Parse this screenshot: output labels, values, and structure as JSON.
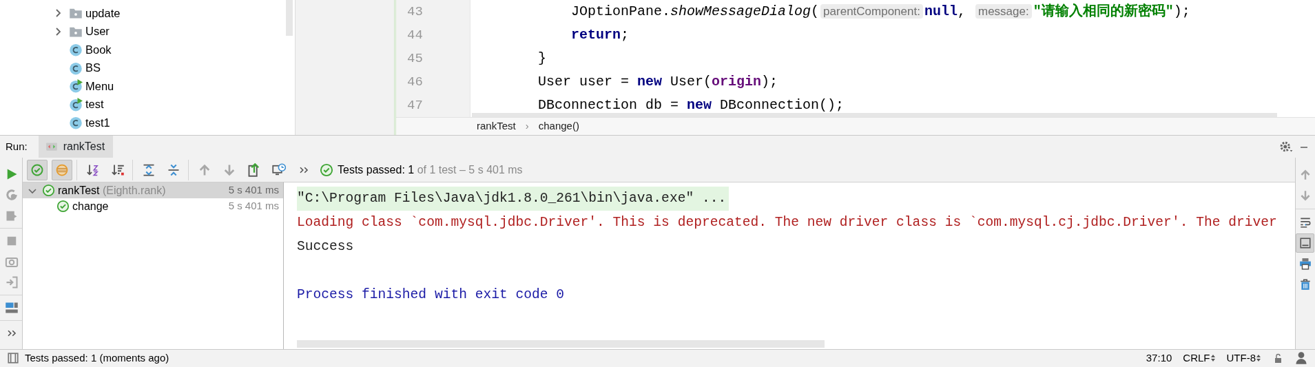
{
  "project_tree": {
    "items": [
      {
        "label": "update",
        "kind": "folder",
        "expanded": false
      },
      {
        "label": "User",
        "kind": "folder",
        "expanded": false
      },
      {
        "label": "Book",
        "kind": "class"
      },
      {
        "label": "BS",
        "kind": "class"
      },
      {
        "label": "Menu",
        "kind": "runnable-class"
      },
      {
        "label": "test",
        "kind": "runnable-class"
      },
      {
        "label": "test1",
        "kind": "class"
      }
    ]
  },
  "editor": {
    "lines": [
      {
        "number": "43",
        "tokens": [
          {
            "kind": "plain",
            "text": "            JOptionPane."
          },
          {
            "kind": "method",
            "text": "showMessageDialog"
          },
          {
            "kind": "plain",
            "text": "("
          },
          {
            "kind": "hint",
            "text": "parentComponent:"
          },
          {
            "kind": "keyword",
            "text": "null"
          },
          {
            "kind": "plain",
            "text": ", "
          },
          {
            "kind": "hint",
            "text": "message:"
          },
          {
            "kind": "string",
            "text": "\"请输入相同的新密码\""
          },
          {
            "kind": "plain",
            "text": ");"
          }
        ]
      },
      {
        "number": "44",
        "tokens": [
          {
            "kind": "keyword",
            "text": "            return"
          },
          {
            "kind": "plain",
            "text": ";"
          }
        ]
      },
      {
        "number": "45",
        "tokens": [
          {
            "kind": "plain",
            "text": "        }"
          }
        ]
      },
      {
        "number": "46",
        "tokens": [
          {
            "kind": "plain",
            "text": "        User user = "
          },
          {
            "kind": "keyword",
            "text": "new"
          },
          {
            "kind": "plain",
            "text": " User("
          },
          {
            "kind": "field",
            "text": "origin"
          },
          {
            "kind": "plain",
            "text": ");"
          }
        ]
      },
      {
        "number": "47",
        "tokens": [
          {
            "kind": "plain",
            "text": "        DBconnection db = "
          },
          {
            "kind": "keyword",
            "text": "new"
          },
          {
            "kind": "plain",
            "text": " DBconnection();"
          }
        ]
      }
    ],
    "breadcrumbs": [
      "rankTest",
      "change()"
    ],
    "separator": "›"
  },
  "run_panel": {
    "label": "Run:",
    "tabs": [
      {
        "label": "rankTest",
        "selected": true
      }
    ],
    "side_toolbar": [
      [
        {
          "kind": "run",
          "disabled": false
        },
        {
          "kind": "rerun-failed",
          "disabled": true
        },
        {
          "kind": "auto-test",
          "disabled": true
        }
      ],
      [
        {
          "kind": "stop",
          "disabled": true
        },
        {
          "kind": "camera",
          "disabled": true
        },
        {
          "kind": "exit",
          "disabled": true
        }
      ],
      [
        {
          "kind": "layout",
          "disabled": false
        }
      ],
      [
        {
          "kind": "more",
          "disabled": false
        }
      ]
    ],
    "toolbar": [
      [
        {
          "kind": "filter-passed",
          "on": true,
          "disabled": false
        },
        {
          "kind": "filter-ignored",
          "on": true,
          "disabled": false
        }
      ],
      [
        {
          "kind": "sort-alpha",
          "on": false,
          "disabled": false
        },
        {
          "kind": "sort-duration",
          "on": false,
          "disabled": false
        }
      ],
      [
        {
          "kind": "expand-all",
          "on": false,
          "disabled": false
        },
        {
          "kind": "collapse-all",
          "on": false,
          "disabled": false
        }
      ],
      [
        {
          "kind": "previous",
          "on": false,
          "disabled": true
        },
        {
          "kind": "next",
          "on": false,
          "disabled": true
        },
        {
          "kind": "export",
          "on": false,
          "disabled": false
        },
        {
          "kind": "history",
          "on": false,
          "disabled": false
        },
        {
          "kind": "more",
          "on": false,
          "disabled": false
        }
      ]
    ],
    "summary": {
      "status": "Tests passed:",
      "count": "1",
      "detail": "of 1 test – 5 s 401 ms"
    },
    "tests": [
      {
        "name": "rankTest",
        "qualifier": "(Eighth.rank)",
        "time": "5 s 401 ms",
        "passed": true,
        "selected": true,
        "expanded": true,
        "children": [
          {
            "name": "change",
            "time": "5 s 401 ms",
            "passed": true,
            "selected": false
          }
        ]
      }
    ],
    "console": [
      {
        "kind": "command",
        "text": "\"C:\\Program Files\\Java\\jdk1.8.0_261\\bin\\java.exe\" ..."
      },
      {
        "kind": "stderr",
        "text": "Loading class `com.mysql.jdbc.Driver'. This is deprecated. The new driver class is `com.mysql.cj.jdbc.Driver'. The driver"
      },
      {
        "kind": "stdout",
        "text": "Success"
      },
      {
        "kind": "system",
        "text": "Process finished with exit code 0"
      }
    ],
    "right_toolbar": [
      [
        {
          "kind": "up",
          "on": false,
          "disabled": true
        },
        {
          "kind": "down",
          "on": false,
          "disabled": true
        }
      ],
      [
        {
          "kind": "soft-wrap",
          "on": false,
          "disabled": false
        },
        {
          "kind": "scroll-end",
          "on": true,
          "disabled": false
        },
        {
          "kind": "print",
          "on": false,
          "disabled": false
        },
        {
          "kind": "trash",
          "on": false,
          "disabled": false
        }
      ]
    ]
  },
  "status_bar": {
    "message": "Tests passed: 1 (moments ago)",
    "position": "37:10",
    "line_separator": "CRLF",
    "encoding": "UTF-8"
  }
}
